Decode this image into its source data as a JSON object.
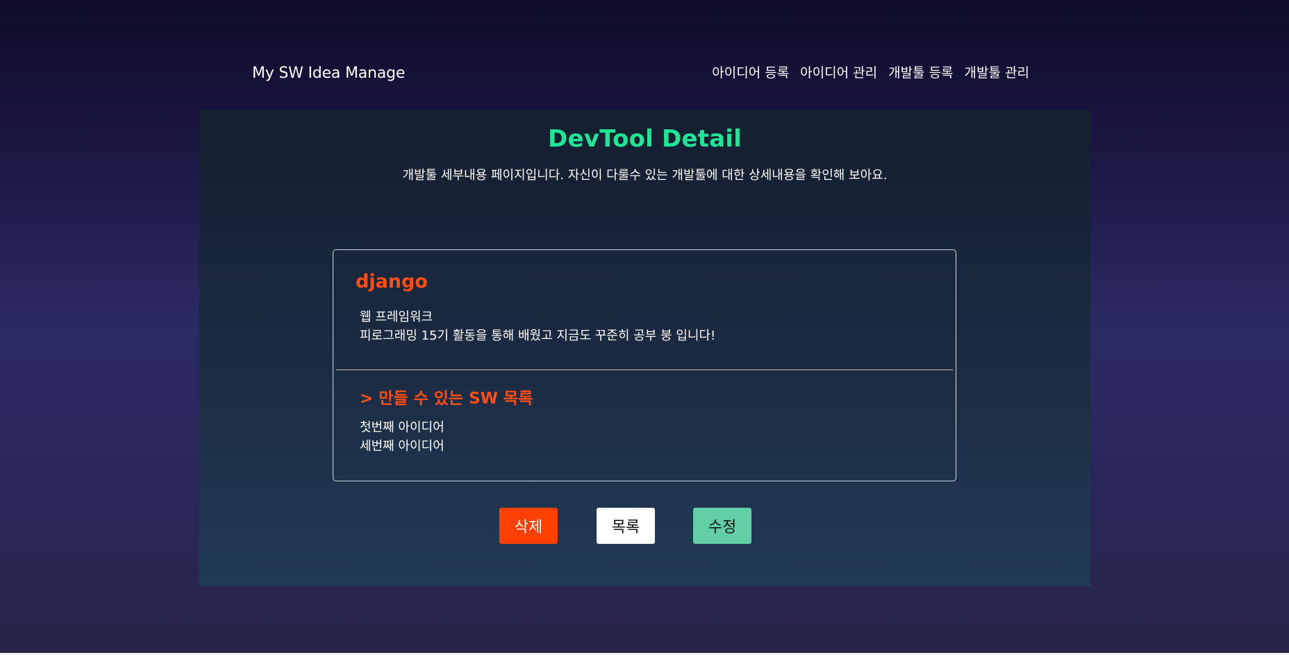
{
  "header": {
    "brand": "My SW Idea Manage",
    "nav": [
      {
        "label": "아이디어 등록"
      },
      {
        "label": "아이디어 관리"
      },
      {
        "label": "개발툴 등록"
      },
      {
        "label": "개발툴 관리"
      }
    ]
  },
  "page": {
    "title": "DevTool Detail",
    "subtitle": "개발툴 세부내용 페이지입니다. 자신이 다룰수 있는 개발툴에 대한 상세내용을 확인해 보아요."
  },
  "tool": {
    "name": "django",
    "kind": "웹 프레임워크",
    "content": "피로그래밍 15기 활동을 통해 배웠고 지금도 꾸준히 공부 붕 입니다!"
  },
  "ideas": {
    "heading": "> 만들 수 있는 SW 목록",
    "items": [
      {
        "title": "첫번째 아이디어"
      },
      {
        "title": "세번째 아이디어"
      }
    ]
  },
  "actions": {
    "delete_label": "삭제",
    "list_label": "목록",
    "edit_label": "수정"
  },
  "colors": {
    "accent_title": "#1fe596",
    "accent_tool": "#ff4d14",
    "delete_button": "#ff4000",
    "edit_button": "#63cfa6"
  }
}
